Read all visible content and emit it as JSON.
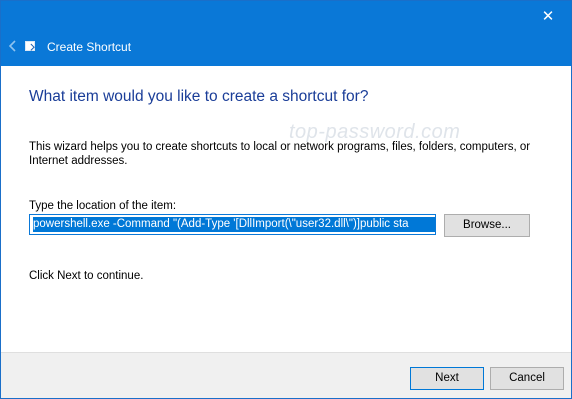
{
  "window": {
    "title": "Create Shortcut",
    "close_glyph": "✕",
    "back_icon": "back-arrow-icon",
    "accent_color": "#0a78d7"
  },
  "page": {
    "heading": "What item would you like to create a shortcut for?",
    "description": "This wizard helps you to create shortcuts to local or network programs, files, folders, computers, or Internet addresses.",
    "location_label": "Type the location of the item:",
    "location_value": "powershell.exe -Command \"(Add-Type '[DllImport(\\\"user32.dll\\\")]public sta",
    "browse_label": "Browse...",
    "continue_text": "Click Next to continue.",
    "watermark": "top-password.com"
  },
  "footer": {
    "next_label": "Next",
    "cancel_label": "Cancel"
  }
}
